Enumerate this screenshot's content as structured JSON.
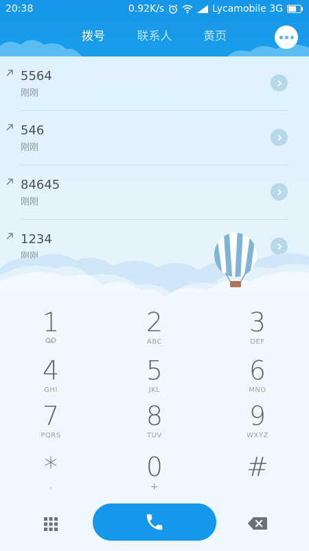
{
  "status_bar": {
    "time": "20:38",
    "speed": "0.92K/s",
    "carrier": "Lycamobile 3G"
  },
  "tabs": [
    {
      "label": "拨号",
      "active": true
    },
    {
      "label": "联系人",
      "active": false
    },
    {
      "label": "黄页",
      "active": false
    }
  ],
  "call_log": [
    {
      "number": "5564",
      "time": "刚刚"
    },
    {
      "number": "546",
      "time": "刚刚"
    },
    {
      "number": "84645",
      "time": "刚刚"
    },
    {
      "number": "1234",
      "time": "刚刚"
    }
  ],
  "keypad": [
    {
      "digit": "1",
      "letters": ""
    },
    {
      "digit": "2",
      "letters": "ABC"
    },
    {
      "digit": "3",
      "letters": "DEF"
    },
    {
      "digit": "4",
      "letters": "GHI"
    },
    {
      "digit": "5",
      "letters": "JKL"
    },
    {
      "digit": "6",
      "letters": "MNO"
    },
    {
      "digit": "7",
      "letters": "PQRS"
    },
    {
      "digit": "8",
      "letters": "TUV"
    },
    {
      "digit": "9",
      "letters": "WXYZ"
    },
    {
      "digit": "*",
      "letters": ","
    },
    {
      "digit": "0",
      "letters": "+"
    },
    {
      "digit": "#",
      "letters": ""
    }
  ],
  "colors": {
    "header": "#1596e8",
    "call_button": "#1597ea",
    "background": "#eaf6fd"
  }
}
